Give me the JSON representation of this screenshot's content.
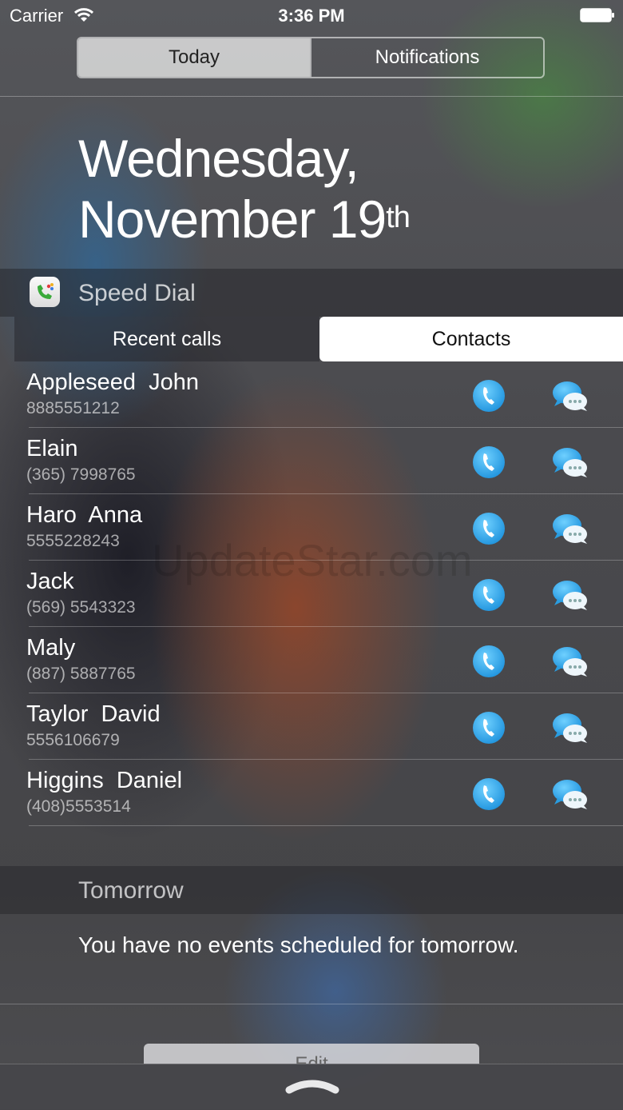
{
  "status_bar": {
    "carrier": "Carrier",
    "time": "3:36 PM"
  },
  "top_tabs": [
    {
      "label": "Today",
      "active": true
    },
    {
      "label": "Notifications",
      "active": false
    }
  ],
  "date": {
    "line1": "Wednesday,",
    "line2": "November 19",
    "suffix": "th"
  },
  "widget": {
    "title": "Speed Dial",
    "icon": "phone-app-icon",
    "tabs": [
      {
        "label": "Recent calls",
        "active": false
      },
      {
        "label": "Contacts",
        "active": true
      }
    ],
    "contacts": [
      {
        "name": "Appleseed  John",
        "phone": "8885551212"
      },
      {
        "name": "Elain",
        "phone": "(365) 7998765"
      },
      {
        "name": "Haro  Anna",
        "phone": "5555228243"
      },
      {
        "name": "Jack",
        "phone": "(569) 5543323"
      },
      {
        "name": "Maly",
        "phone": "(887) 5887765"
      },
      {
        "name": "Taylor  David",
        "phone": "5556106679"
      },
      {
        "name": "Higgins  Daniel",
        "phone": "(408)5553514"
      }
    ]
  },
  "watermark": "UpdateStar.com",
  "tomorrow": {
    "label": "Tomorrow",
    "message": "You have no events scheduled for tomorrow."
  },
  "edit_label": "Edit",
  "colors": {
    "accent_blue": "#27a4ea",
    "active_tab": "#ffffff"
  }
}
